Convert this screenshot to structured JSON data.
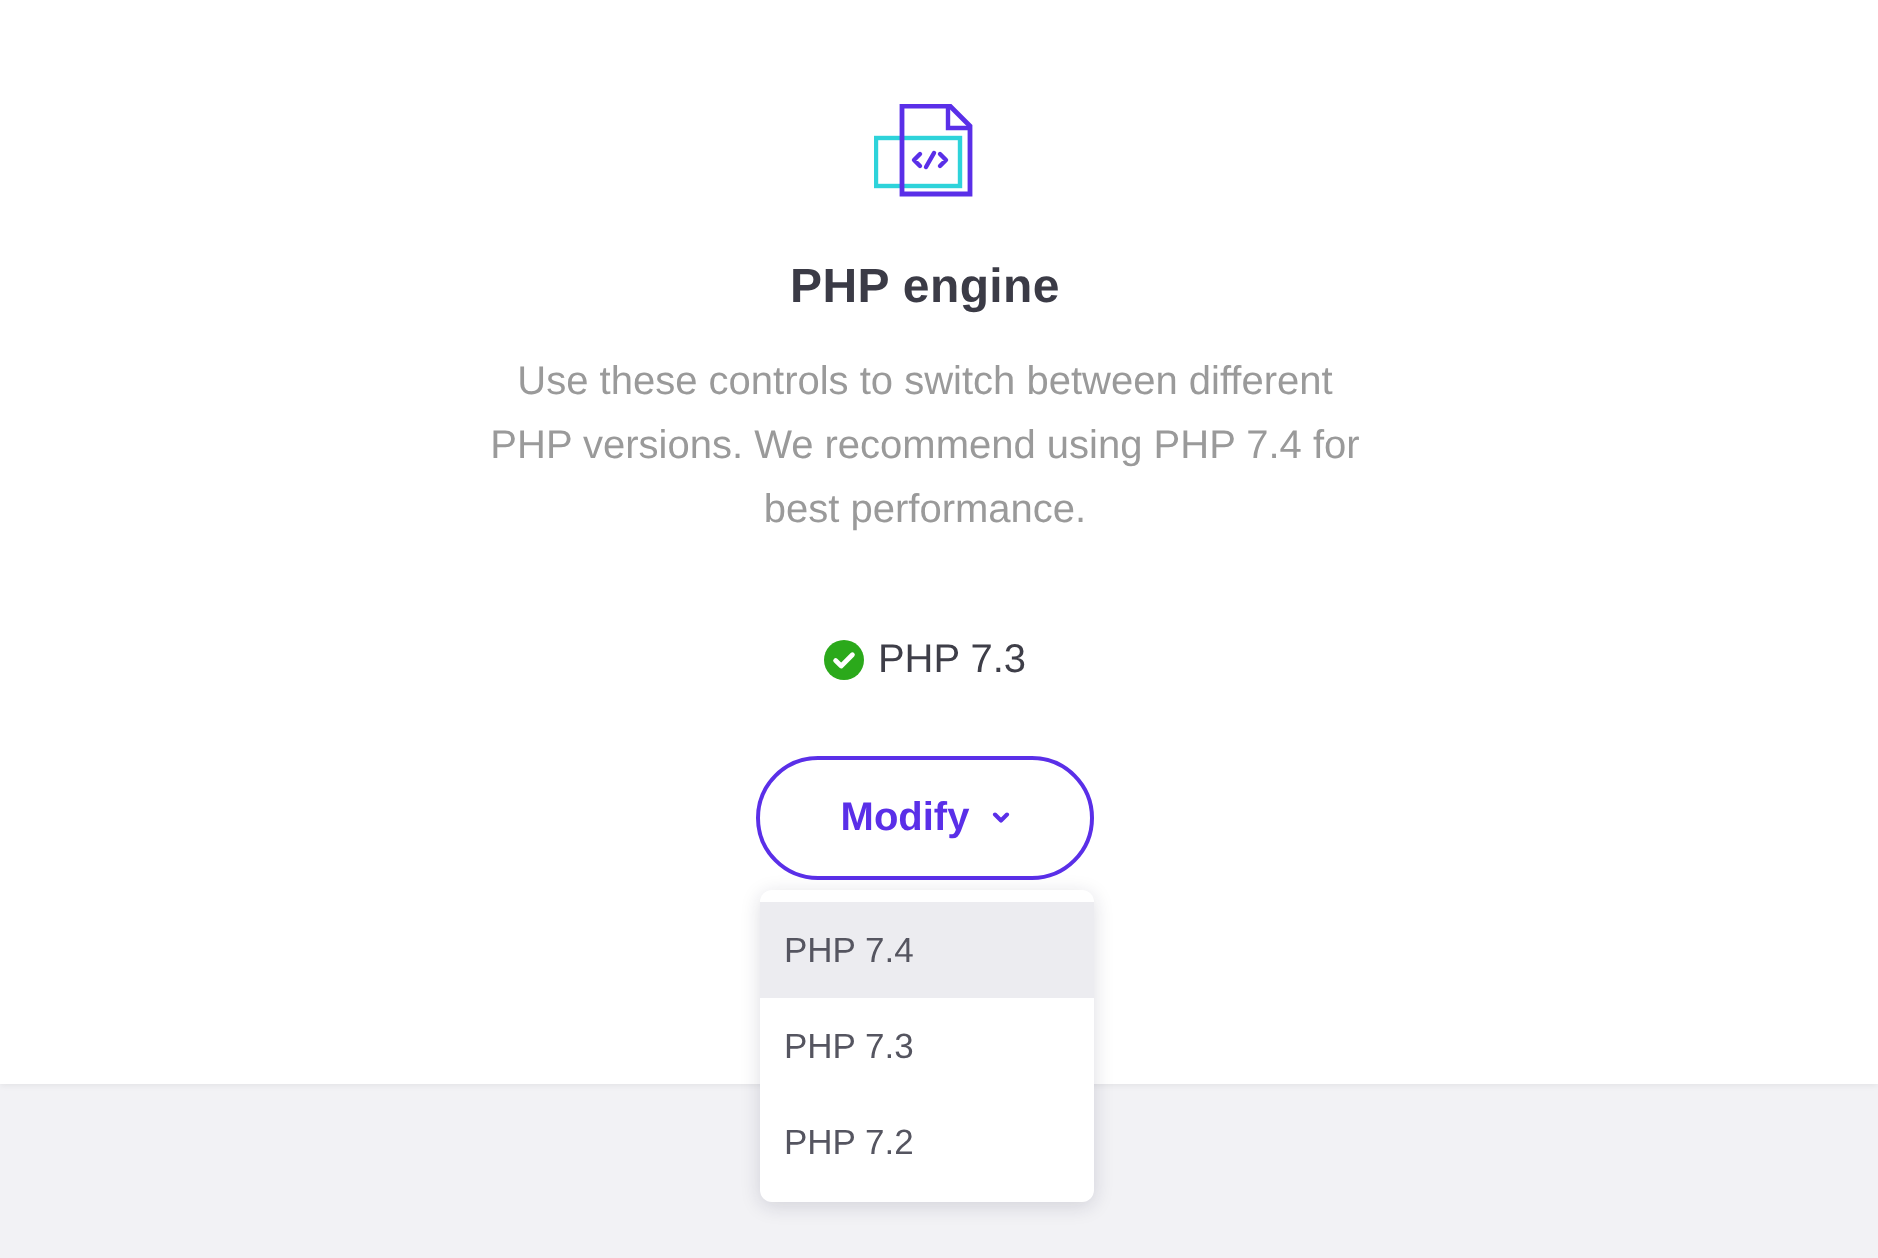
{
  "section": {
    "title": "PHP engine",
    "description": "Use these controls to switch between different PHP versions. We recommend using PHP 7.4 for best performance."
  },
  "current_version": {
    "label": "PHP 7.3"
  },
  "modify_button": {
    "label": "Modify",
    "expanded": true
  },
  "version_menu": [
    {
      "label": "PHP 7.4",
      "selected": true
    },
    {
      "label": "PHP 7.3",
      "selected": false
    },
    {
      "label": "PHP 7.2",
      "selected": false
    }
  ]
}
